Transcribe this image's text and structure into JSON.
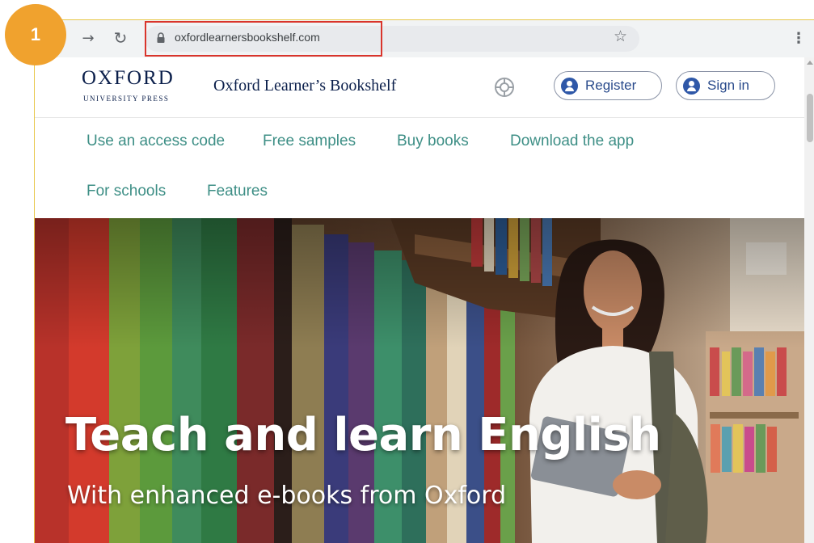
{
  "step": {
    "number": "1"
  },
  "browser": {
    "url": "oxfordlearnersbookshelf.com",
    "icons": {
      "back": "back-arrow-icon",
      "reload": "reload-icon",
      "lock": "lock-icon",
      "bookmark": "star-icon",
      "menu": "kebab-menu-icon"
    }
  },
  "header": {
    "logo_main": "OXFORD",
    "logo_sub": "UNIVERSITY PRESS",
    "site_title": "Oxford Learner’s Bookshelf",
    "register_label": "Register",
    "signin_label": "Sign in"
  },
  "nav": {
    "items": [
      "Use an access code",
      "Free samples",
      "Buy books",
      "Download the app",
      "For schools",
      "Features"
    ]
  },
  "hero": {
    "title": "Teach and learn English",
    "subtitle": "With enhanced e-books from Oxford"
  },
  "colors": {
    "brand_navy": "#0b1f4b",
    "nav_teal": "#3e8f86",
    "step_badge": "#f0a22e",
    "highlight_red": "#d9342b"
  }
}
